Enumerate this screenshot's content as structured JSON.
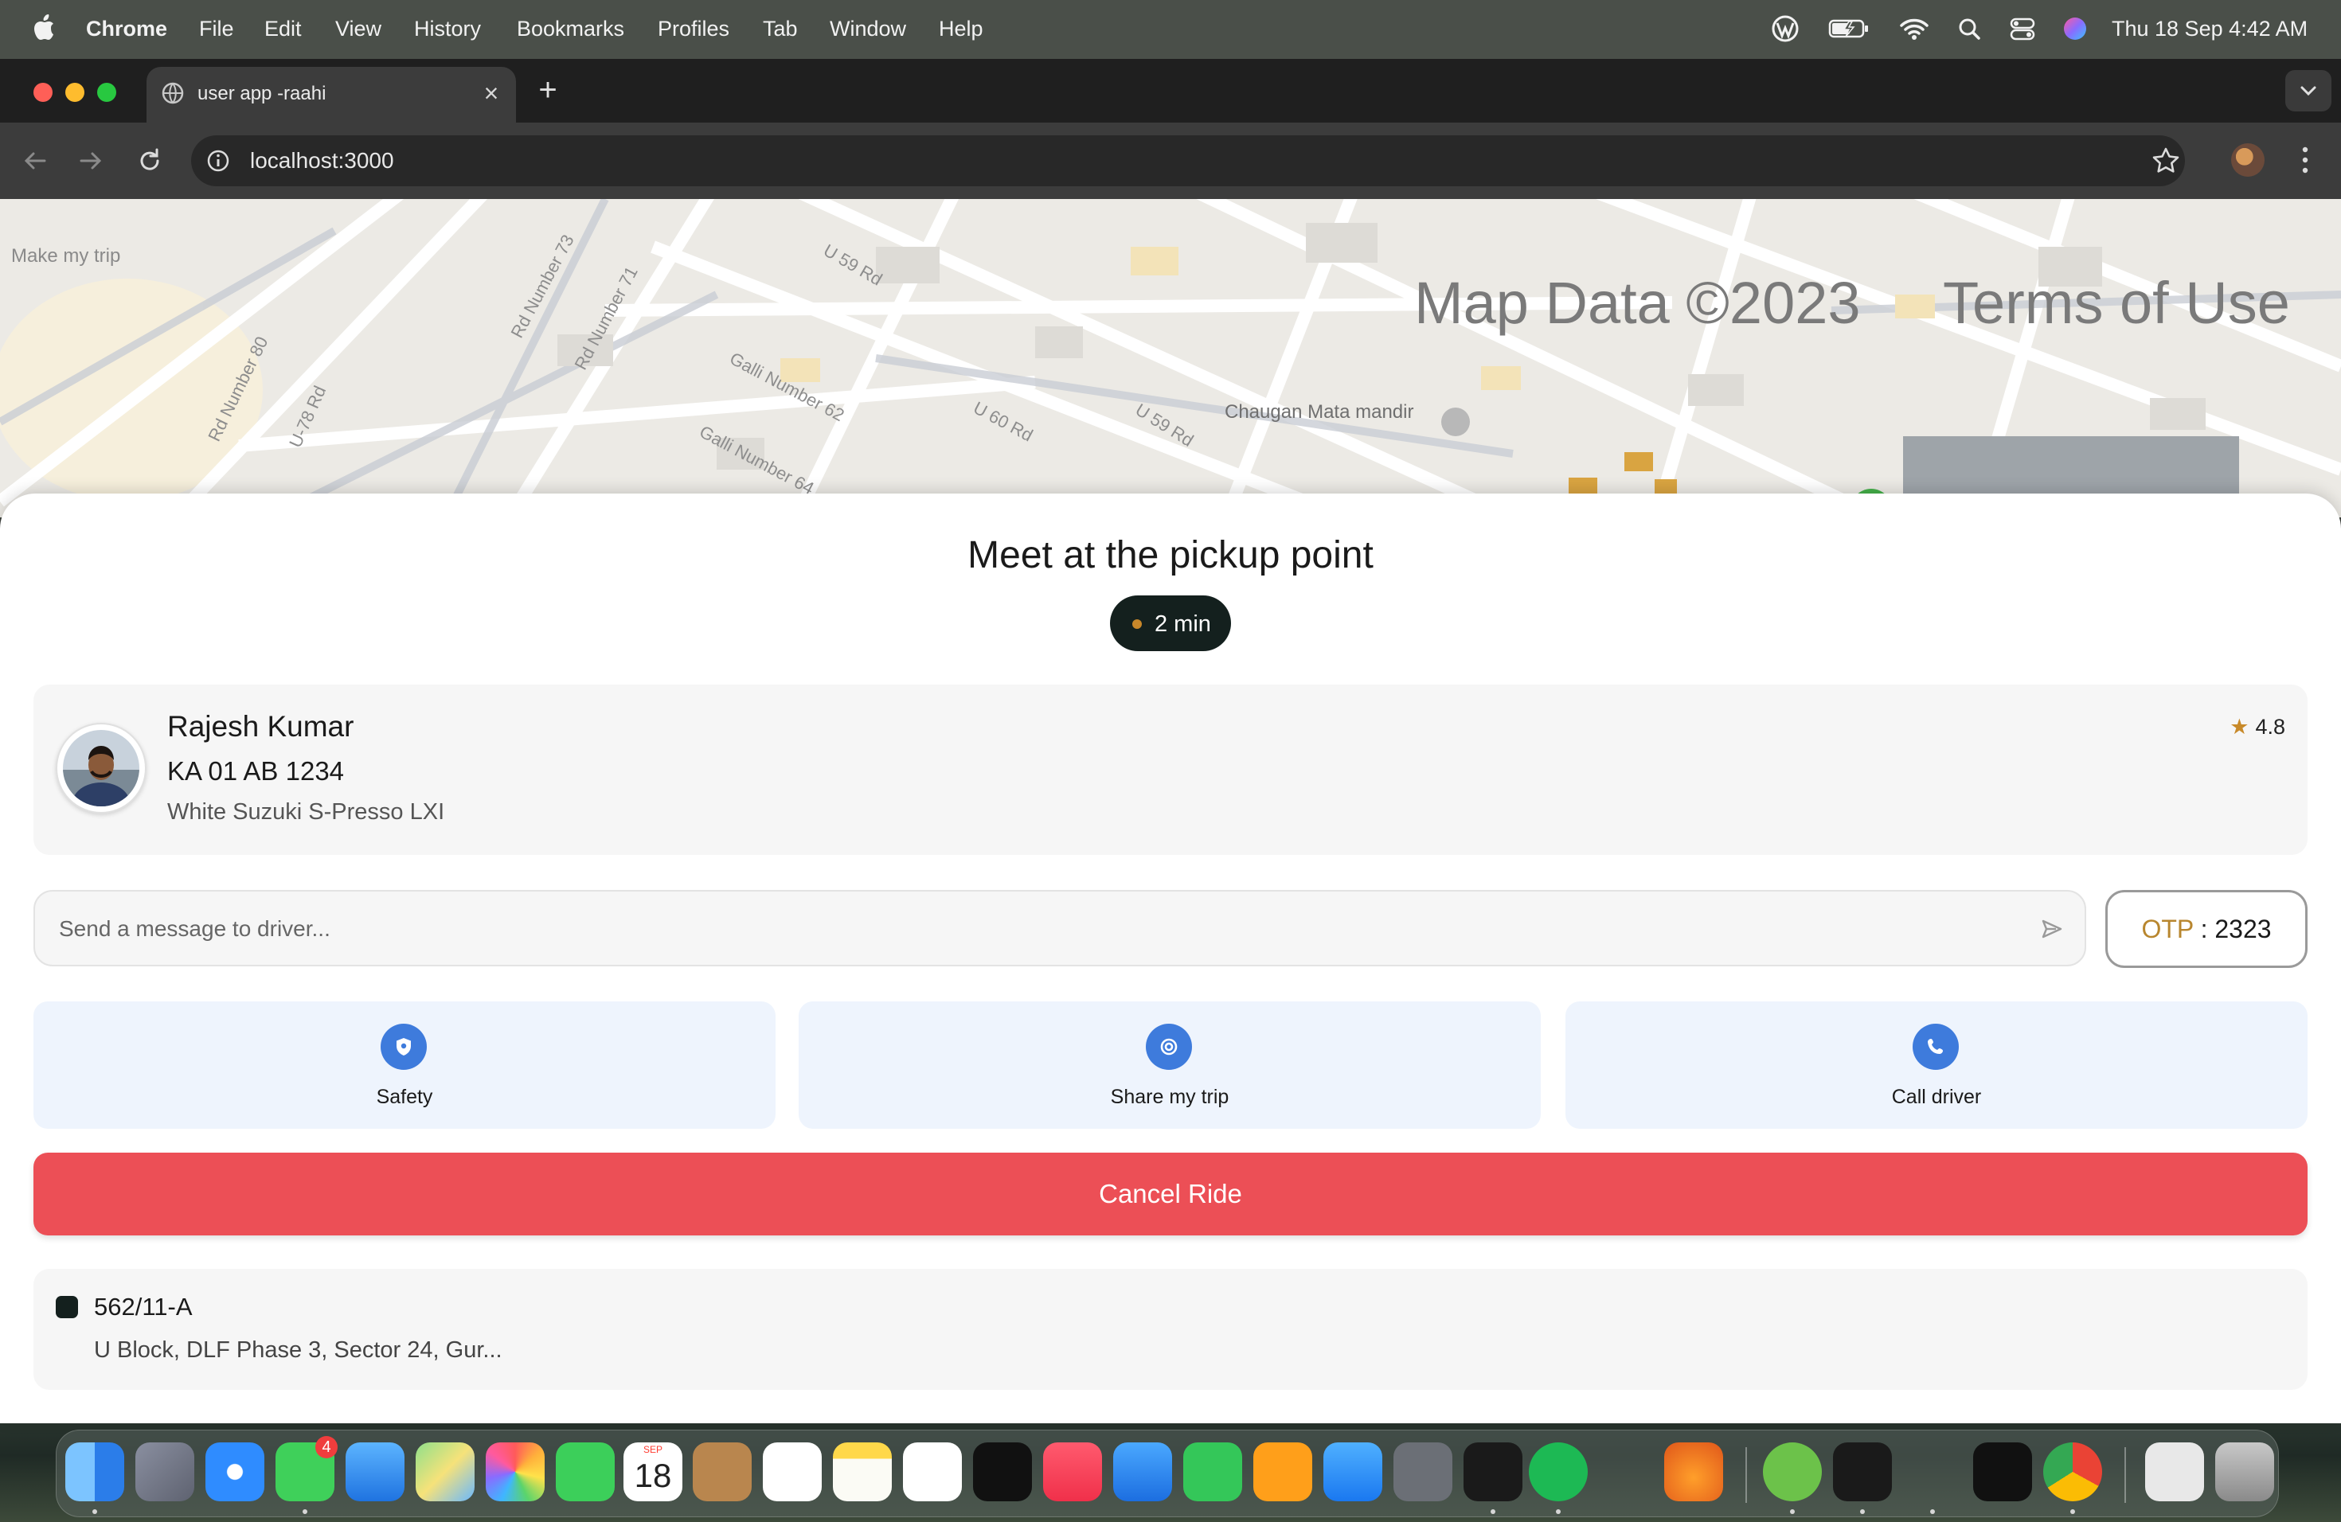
{
  "menubar": {
    "app": "Chrome",
    "items": [
      "File",
      "Edit",
      "View",
      "History",
      "Bookmarks",
      "Profiles",
      "Tab",
      "Window",
      "Help"
    ],
    "clock": "Thu 18 Sep  4:42 AM"
  },
  "browser": {
    "tab_title": "user app -raahi",
    "url": "localhost:3000"
  },
  "map": {
    "data_label": "Map Data ©2023",
    "terms_label": "Terms of Use",
    "poi": "Chaugan Mata mandir",
    "make_my_trip": "Make my trip",
    "roads": [
      "U 59 Rd",
      "Galli Number 62",
      "U 60 Rd",
      "U 59 Rd",
      "Galli Number 64",
      "Rd Number 73",
      "Rd Number 71",
      "Rd Number 80",
      "U-78 Rd"
    ]
  },
  "sheet": {
    "title": "Meet at the pickup point",
    "eta": "2 min"
  },
  "driver": {
    "name": "Rajesh Kumar",
    "plate": "KA 01 AB 1234",
    "car": "White Suzuki S-Presso LXI",
    "rating": "4.8"
  },
  "message": {
    "placeholder": "Send a message to driver..."
  },
  "otp": {
    "label": "OTP",
    "separator": " : ",
    "value": "2323"
  },
  "actions": [
    {
      "label": "Safety",
      "icon": "shield-icon"
    },
    {
      "label": "Share my trip",
      "icon": "target-icon"
    },
    {
      "label": "Call driver",
      "icon": "phone-icon"
    }
  ],
  "cancel_label": "Cancel Ride",
  "pickup": {
    "title": "562/11-A",
    "address": "U Block, DLF Phase 3, Sector 24, Gur..."
  },
  "dock": {
    "messages_badge": "4",
    "calendar_month": "SEP",
    "calendar_day": "18"
  },
  "colors": {
    "accent_blue": "#3e7bdc",
    "cancel_red": "#ec4f56",
    "dark": "#14201e",
    "otp_gold": "#b8862e",
    "action_bg": "#eef4fd"
  }
}
